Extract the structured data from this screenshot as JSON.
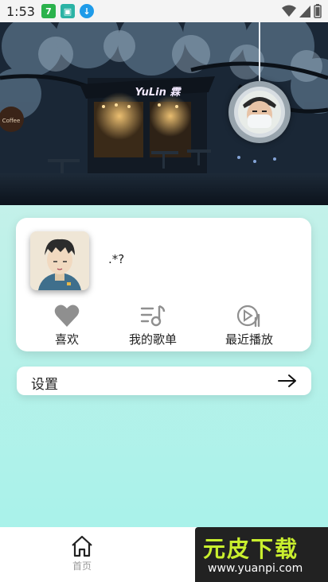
{
  "status_bar": {
    "time": "1:53",
    "badge_number": "7",
    "icons": [
      "notification-7-icon",
      "gallery-app-icon",
      "download-icon",
      "wifi-icon",
      "signal-icon",
      "battery-icon"
    ]
  },
  "hero": {
    "sign_text": "YuLin 霖",
    "cafe_sign": "Coffee"
  },
  "profile": {
    "nickname": ".*?",
    "actions": [
      {
        "label": "喜欢",
        "icon": "heart-icon"
      },
      {
        "label": "我的歌单",
        "icon": "playlist-icon"
      },
      {
        "label": "最近播放",
        "icon": "recent-play-icon"
      }
    ]
  },
  "settings": {
    "label": "设置",
    "icon": "arrow-right-icon"
  },
  "bottom_nav": {
    "home_label": "首页"
  },
  "watermark": {
    "logo": "元皮下载",
    "url": "www.yuanpi.com"
  },
  "colors": {
    "background_top": "#d6f1ea",
    "background_bottom": "#a5f2ea",
    "card": "#ffffff",
    "watermark_accent": "#c9ef2e"
  }
}
